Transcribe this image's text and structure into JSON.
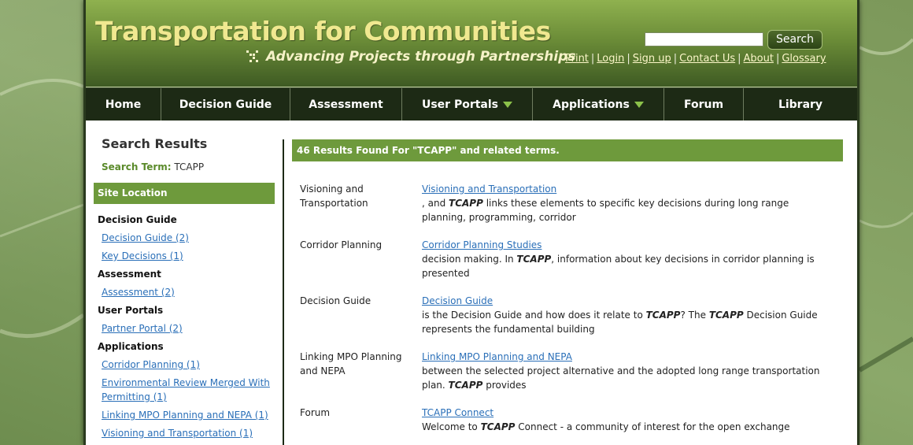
{
  "header": {
    "site_title": "Transportation for Communities",
    "tagline": "Advancing Projects through Partnerships",
    "search_placeholder": "",
    "search_button": "Search",
    "links": [
      "Print",
      "Login",
      "Sign up",
      "Contact Us",
      "About",
      "Glossary"
    ]
  },
  "nav": {
    "items": [
      {
        "label": "Home"
      },
      {
        "label": "Decision Guide"
      },
      {
        "label": "Assessment"
      },
      {
        "label": "User Portals"
      },
      {
        "label": "Applications"
      },
      {
        "label": "Forum"
      },
      {
        "label": "Library"
      }
    ]
  },
  "sidebar": {
    "title": "Search Results",
    "search_term_label": "Search Term:",
    "search_term": "TCAPP",
    "site_location": "Site Location",
    "groups": [
      {
        "name": "Decision Guide",
        "links": [
          "Decision Guide (2)",
          "Key Decisions (1)"
        ]
      },
      {
        "name": "Assessment",
        "links": [
          "Assessment (2)"
        ]
      },
      {
        "name": "User Portals",
        "links": [
          "Partner Portal (2)"
        ]
      },
      {
        "name": "Applications",
        "links": [
          "Corridor Planning (1)",
          "Environmental Review Merged With Permitting (1)",
          "Linking MPO Planning and NEPA (1)",
          "Visioning and Transportation (1)"
        ]
      }
    ]
  },
  "results": {
    "header": "46 Results Found For \"TCAPP\" and related terms.",
    "items": [
      {
        "category": "Visioning and Transportation",
        "title": "Visioning and Transportation",
        "snippet_pre": ", and ",
        "snippet_em": "TCAPP",
        "snippet_post": " links these elements to specific key decisions during long range planning, programming, corridor"
      },
      {
        "category": "Corridor Planning",
        "title": "Corridor Planning Studies",
        "snippet_pre": "decision making. In ",
        "snippet_em": "TCAPP",
        "snippet_post": ", information about key decisions in corridor planning is presented"
      },
      {
        "category": "Decision Guide",
        "title": "Decision Guide",
        "snippet_pre": "is the Decision Guide and how does it relate to ",
        "snippet_em": "TCAPP",
        "snippet_mid": "? The ",
        "snippet_em2": "TCAPP",
        "snippet_post": " Decision Guide represents the fundamental building"
      },
      {
        "category": "Linking MPO Planning and NEPA",
        "title": "Linking MPO Planning and NEPA",
        "snippet_pre": "between the selected project alternative and the adopted long range transportation plan. ",
        "snippet_em": "TCAPP",
        "snippet_post": " provides"
      },
      {
        "category": "Forum",
        "title": "TCAPP Connect",
        "snippet_pre": "Welcome to ",
        "snippet_em": "TCAPP",
        "snippet_post": " Connect - a community of interest for the open exchange"
      }
    ]
  }
}
